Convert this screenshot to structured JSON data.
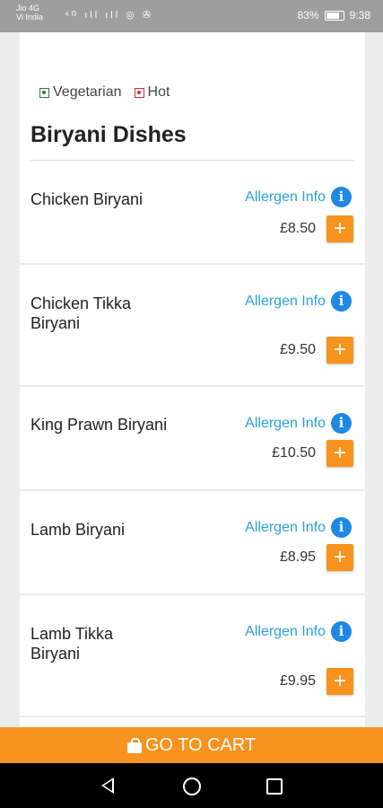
{
  "status_bar": {
    "carrier_line1": "Jio 4G",
    "carrier_line2": "Vi India",
    "icons": "⁴ᴳ ıll ıll ◎ ✇",
    "battery": "83%",
    "time": "9:38"
  },
  "legend": {
    "vegetarian_label": "Vegetarian",
    "hot_label": "Hot"
  },
  "section_title": "Biryani Dishes",
  "items": [
    {
      "name": "Chicken Biryani",
      "allergen_label": "Allergen Info",
      "price": "£8.50"
    },
    {
      "name": "Chicken Tikka Biryani",
      "allergen_label": "Allergen Info",
      "price": "£9.50"
    },
    {
      "name": "King Prawn Biryani",
      "allergen_label": "Allergen Info",
      "price": "£10.50"
    },
    {
      "name": "Lamb Biryani",
      "allergen_label": "Allergen Info",
      "price": "£8.95"
    },
    {
      "name": "Lamb Tikka Biryani",
      "allergen_label": "Allergen Info",
      "price": "£9.95"
    }
  ],
  "cart": {
    "label": "GO TO CART"
  },
  "colors": {
    "accent": "#f7931e",
    "link": "#29a3d8",
    "info": "#1e88e5",
    "veg": "#2e7d32",
    "hot": "#d32f2f"
  }
}
